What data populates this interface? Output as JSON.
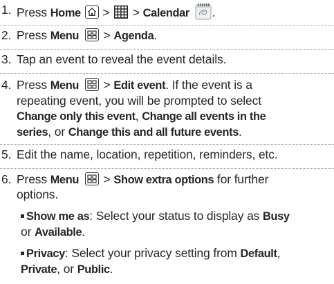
{
  "steps": [
    {
      "number": "1.",
      "lines": [
        [
          "Press ",
          {
            "b": "Home"
          },
          " ",
          {
            "icon": "home-key-icon"
          },
          " > ",
          {
            "icon": "apps-grid-icon"
          },
          " > ",
          {
            "b": "Calendar"
          },
          " ",
          {
            "icon": "calendar-app-icon"
          },
          "."
        ]
      ]
    },
    {
      "number": "2.",
      "lines": [
        [
          "Press ",
          {
            "b": "Menu"
          },
          " ",
          {
            "icon": "menu-key-icon"
          },
          " > ",
          {
            "b": "Agenda"
          },
          "."
        ]
      ]
    },
    {
      "number": "3.",
      "lines": [
        [
          "Tap an event to reveal the event details."
        ]
      ]
    },
    {
      "number": "4.",
      "lines": [
        [
          "Press ",
          {
            "b": "Menu"
          },
          " ",
          {
            "icon": "menu-key-icon"
          },
          " > ",
          {
            "b": "Edit event"
          },
          ". If the event is a"
        ],
        [
          "repeating event, you will be prompted to select"
        ],
        [
          {
            "b": "Change only this event"
          },
          ", ",
          {
            "b": "Change all events in the"
          }
        ],
        [
          {
            "b": "series"
          },
          ", or ",
          {
            "b": "Change this and all future events"
          },
          "."
        ]
      ]
    },
    {
      "number": "5.",
      "lines": [
        [
          "Edit the name, location, repetition, reminders, etc."
        ]
      ]
    },
    {
      "number": "6.",
      "lines": [
        [
          "Press ",
          {
            "b": "Menu"
          },
          " ",
          {
            "icon": "menu-key-icon"
          },
          " > ",
          {
            "b": "Show extra options"
          },
          " for further"
        ],
        [
          "options."
        ]
      ]
    }
  ],
  "bullets": [
    {
      "lines": [
        [
          {
            "b": "Show me as"
          },
          ": Select your status to display as ",
          {
            "b": "Busy"
          }
        ],
        [
          "or ",
          {
            "b": "Available"
          },
          "."
        ]
      ]
    },
    {
      "lines": [
        [
          {
            "b": "Privacy"
          },
          ": Select your privacy setting from ",
          {
            "b": "Default"
          },
          ","
        ],
        [
          {
            "b": "Private"
          },
          ", or ",
          {
            "b": "Public"
          },
          "."
        ]
      ]
    }
  ]
}
